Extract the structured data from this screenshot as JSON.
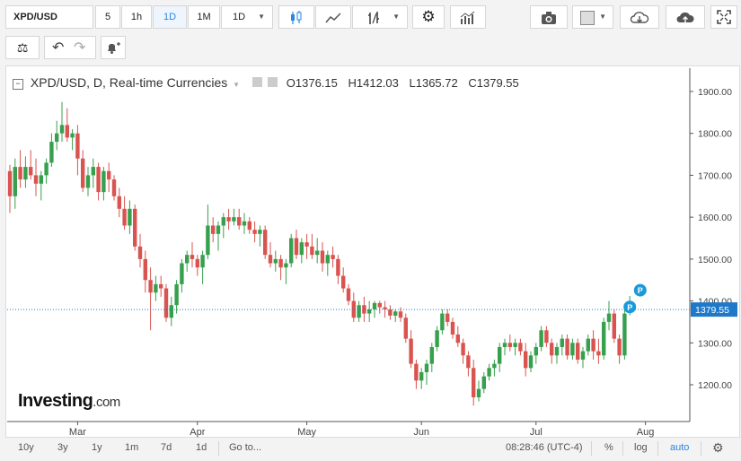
{
  "toolbar": {
    "symbol": "XPD/USD",
    "intervals": [
      "5",
      "1h",
      "1D",
      "1M"
    ],
    "interval_select": "1D",
    "active_interval": "1D"
  },
  "legend": {
    "title": "XPD/USD, D, Real-time Currencies",
    "open": "O1376.15",
    "high": "H1412.03",
    "low": "L1365.72",
    "close": "C1379.55"
  },
  "logo": {
    "name": "Investing",
    "suffix": ".com"
  },
  "bottom_bar": {
    "ranges": [
      "10y",
      "3y",
      "1y",
      "1m",
      "7d",
      "1d"
    ],
    "goto": "Go to...",
    "time": "08:28:46 (UTC-4)",
    "percent": "%",
    "log": "log",
    "auto": "auto"
  },
  "colors": {
    "up": "#37a04d",
    "down": "#d9534f",
    "accent": "#2a86e0",
    "price_label": "#1f78c8"
  },
  "chart_data": {
    "type": "candlestick",
    "title": "XPD/USD, D, Real-time Currencies",
    "ylim": [
      1100,
      1920
    ],
    "y_ticks": [
      1200,
      1300,
      1400,
      1500,
      1600,
      1700,
      1800,
      1900
    ],
    "y_tick_labels": [
      "1200.00",
      "1300.00",
      "1400.00",
      "1500.00",
      "1600.00",
      "1700.00",
      "1800.00",
      "1900.00"
    ],
    "x_ticks": [
      {
        "label": "Mar",
        "index": 13
      },
      {
        "label": "Apr",
        "index": 36
      },
      {
        "label": "May",
        "index": 57
      },
      {
        "label": "Jun",
        "index": 79
      },
      {
        "label": "Jul",
        "index": 101
      },
      {
        "label": "Aug",
        "index": 122
      }
    ],
    "current_price": "1379.55",
    "markers": [
      {
        "label": "P",
        "index": 119,
        "price": 1360
      },
      {
        "label": "P",
        "index": 121,
        "price": 1400
      }
    ],
    "grid": false,
    "ohlc": [
      [
        1710,
        1725,
        1610,
        1650
      ],
      [
        1650,
        1740,
        1620,
        1720
      ],
      [
        1720,
        1760,
        1670,
        1690
      ],
      [
        1690,
        1745,
        1670,
        1720
      ],
      [
        1720,
        1760,
        1690,
        1700
      ],
      [
        1700,
        1740,
        1650,
        1680
      ],
      [
        1680,
        1710,
        1640,
        1700
      ],
      [
        1700,
        1740,
        1680,
        1730
      ],
      [
        1730,
        1800,
        1720,
        1780
      ],
      [
        1780,
        1830,
        1760,
        1800
      ],
      [
        1800,
        1875,
        1780,
        1820
      ],
      [
        1820,
        1860,
        1780,
        1790
      ],
      [
        1790,
        1810,
        1760,
        1800
      ],
      [
        1800,
        1820,
        1700,
        1740
      ],
      [
        1740,
        1760,
        1660,
        1670
      ],
      [
        1670,
        1720,
        1650,
        1700
      ],
      [
        1700,
        1740,
        1670,
        1720
      ],
      [
        1720,
        1730,
        1640,
        1660
      ],
      [
        1660,
        1720,
        1640,
        1710
      ],
      [
        1710,
        1730,
        1660,
        1690
      ],
      [
        1690,
        1700,
        1640,
        1650
      ],
      [
        1650,
        1670,
        1600,
        1620
      ],
      [
        1620,
        1650,
        1570,
        1580
      ],
      [
        1580,
        1640,
        1560,
        1620
      ],
      [
        1620,
        1630,
        1520,
        1530
      ],
      [
        1530,
        1560,
        1480,
        1500
      ],
      [
        1500,
        1520,
        1420,
        1450
      ],
      [
        1450,
        1480,
        1330,
        1420
      ],
      [
        1420,
        1460,
        1400,
        1440
      ],
      [
        1440,
        1460,
        1410,
        1430
      ],
      [
        1430,
        1440,
        1350,
        1360
      ],
      [
        1360,
        1410,
        1340,
        1390
      ],
      [
        1390,
        1450,
        1370,
        1440
      ],
      [
        1440,
        1500,
        1420,
        1490
      ],
      [
        1490,
        1520,
        1470,
        1510
      ],
      [
        1510,
        1540,
        1480,
        1500
      ],
      [
        1500,
        1510,
        1460,
        1480
      ],
      [
        1480,
        1520,
        1440,
        1510
      ],
      [
        1510,
        1630,
        1500,
        1580
      ],
      [
        1580,
        1600,
        1540,
        1560
      ],
      [
        1560,
        1590,
        1520,
        1580
      ],
      [
        1580,
        1610,
        1550,
        1600
      ],
      [
        1600,
        1620,
        1570,
        1590
      ],
      [
        1590,
        1620,
        1580,
        1600
      ],
      [
        1600,
        1620,
        1570,
        1580
      ],
      [
        1580,
        1610,
        1560,
        1590
      ],
      [
        1590,
        1600,
        1560,
        1570
      ],
      [
        1570,
        1590,
        1540,
        1560
      ],
      [
        1560,
        1580,
        1530,
        1570
      ],
      [
        1570,
        1580,
        1500,
        1510
      ],
      [
        1510,
        1540,
        1480,
        1490
      ],
      [
        1490,
        1520,
        1470,
        1500
      ],
      [
        1500,
        1510,
        1450,
        1480
      ],
      [
        1480,
        1500,
        1440,
        1490
      ],
      [
        1490,
        1560,
        1480,
        1550
      ],
      [
        1550,
        1570,
        1500,
        1510
      ],
      [
        1510,
        1550,
        1490,
        1540
      ],
      [
        1540,
        1560,
        1500,
        1530
      ],
      [
        1530,
        1560,
        1500,
        1510
      ],
      [
        1510,
        1550,
        1490,
        1520
      ],
      [
        1520,
        1540,
        1470,
        1490
      ],
      [
        1490,
        1520,
        1460,
        1510
      ],
      [
        1510,
        1530,
        1480,
        1500
      ],
      [
        1500,
        1510,
        1440,
        1460
      ],
      [
        1460,
        1480,
        1420,
        1430
      ],
      [
        1430,
        1440,
        1390,
        1400
      ],
      [
        1400,
        1420,
        1350,
        1360
      ],
      [
        1360,
        1400,
        1350,
        1390
      ],
      [
        1390,
        1410,
        1350,
        1370
      ],
      [
        1370,
        1400,
        1350,
        1380
      ],
      [
        1380,
        1400,
        1360,
        1395
      ],
      [
        1395,
        1400,
        1370,
        1385
      ],
      [
        1385,
        1400,
        1360,
        1380
      ],
      [
        1380,
        1390,
        1355,
        1365
      ],
      [
        1365,
        1380,
        1350,
        1375
      ],
      [
        1375,
        1385,
        1350,
        1360
      ],
      [
        1360,
        1370,
        1300,
        1310
      ],
      [
        1310,
        1330,
        1240,
        1250
      ],
      [
        1250,
        1260,
        1190,
        1210
      ],
      [
        1210,
        1240,
        1190,
        1230
      ],
      [
        1230,
        1260,
        1200,
        1250
      ],
      [
        1250,
        1300,
        1230,
        1290
      ],
      [
        1290,
        1340,
        1280,
        1330
      ],
      [
        1330,
        1380,
        1320,
        1370
      ],
      [
        1370,
        1380,
        1340,
        1350
      ],
      [
        1350,
        1360,
        1310,
        1320
      ],
      [
        1320,
        1340,
        1290,
        1300
      ],
      [
        1300,
        1310,
        1250,
        1270
      ],
      [
        1270,
        1280,
        1220,
        1240
      ],
      [
        1240,
        1260,
        1150,
        1170
      ],
      [
        1170,
        1210,
        1160,
        1190
      ],
      [
        1190,
        1230,
        1180,
        1220
      ],
      [
        1220,
        1250,
        1210,
        1240
      ],
      [
        1240,
        1260,
        1220,
        1250
      ],
      [
        1250,
        1300,
        1230,
        1290
      ],
      [
        1290,
        1310,
        1270,
        1300
      ],
      [
        1300,
        1320,
        1280,
        1290
      ],
      [
        1290,
        1310,
        1270,
        1300
      ],
      [
        1300,
        1310,
        1270,
        1280
      ],
      [
        1280,
        1300,
        1220,
        1240
      ],
      [
        1240,
        1280,
        1230,
        1270
      ],
      [
        1270,
        1300,
        1250,
        1290
      ],
      [
        1290,
        1340,
        1280,
        1330
      ],
      [
        1330,
        1340,
        1290,
        1300
      ],
      [
        1300,
        1310,
        1250,
        1270
      ],
      [
        1270,
        1300,
        1250,
        1290
      ],
      [
        1290,
        1320,
        1270,
        1310
      ],
      [
        1310,
        1320,
        1260,
        1270
      ],
      [
        1270,
        1310,
        1260,
        1300
      ],
      [
        1300,
        1310,
        1250,
        1260
      ],
      [
        1260,
        1290,
        1240,
        1280
      ],
      [
        1280,
        1320,
        1270,
        1310
      ],
      [
        1310,
        1330,
        1260,
        1280
      ],
      [
        1280,
        1310,
        1250,
        1270
      ],
      [
        1270,
        1360,
        1260,
        1350
      ],
      [
        1350,
        1400,
        1330,
        1370
      ],
      [
        1370,
        1380,
        1300,
        1310
      ],
      [
        1310,
        1320,
        1250,
        1270
      ],
      [
        1270,
        1380,
        1260,
        1370
      ],
      [
        1376.15,
        1412.03,
        1365.72,
        1379.55
      ]
    ]
  }
}
